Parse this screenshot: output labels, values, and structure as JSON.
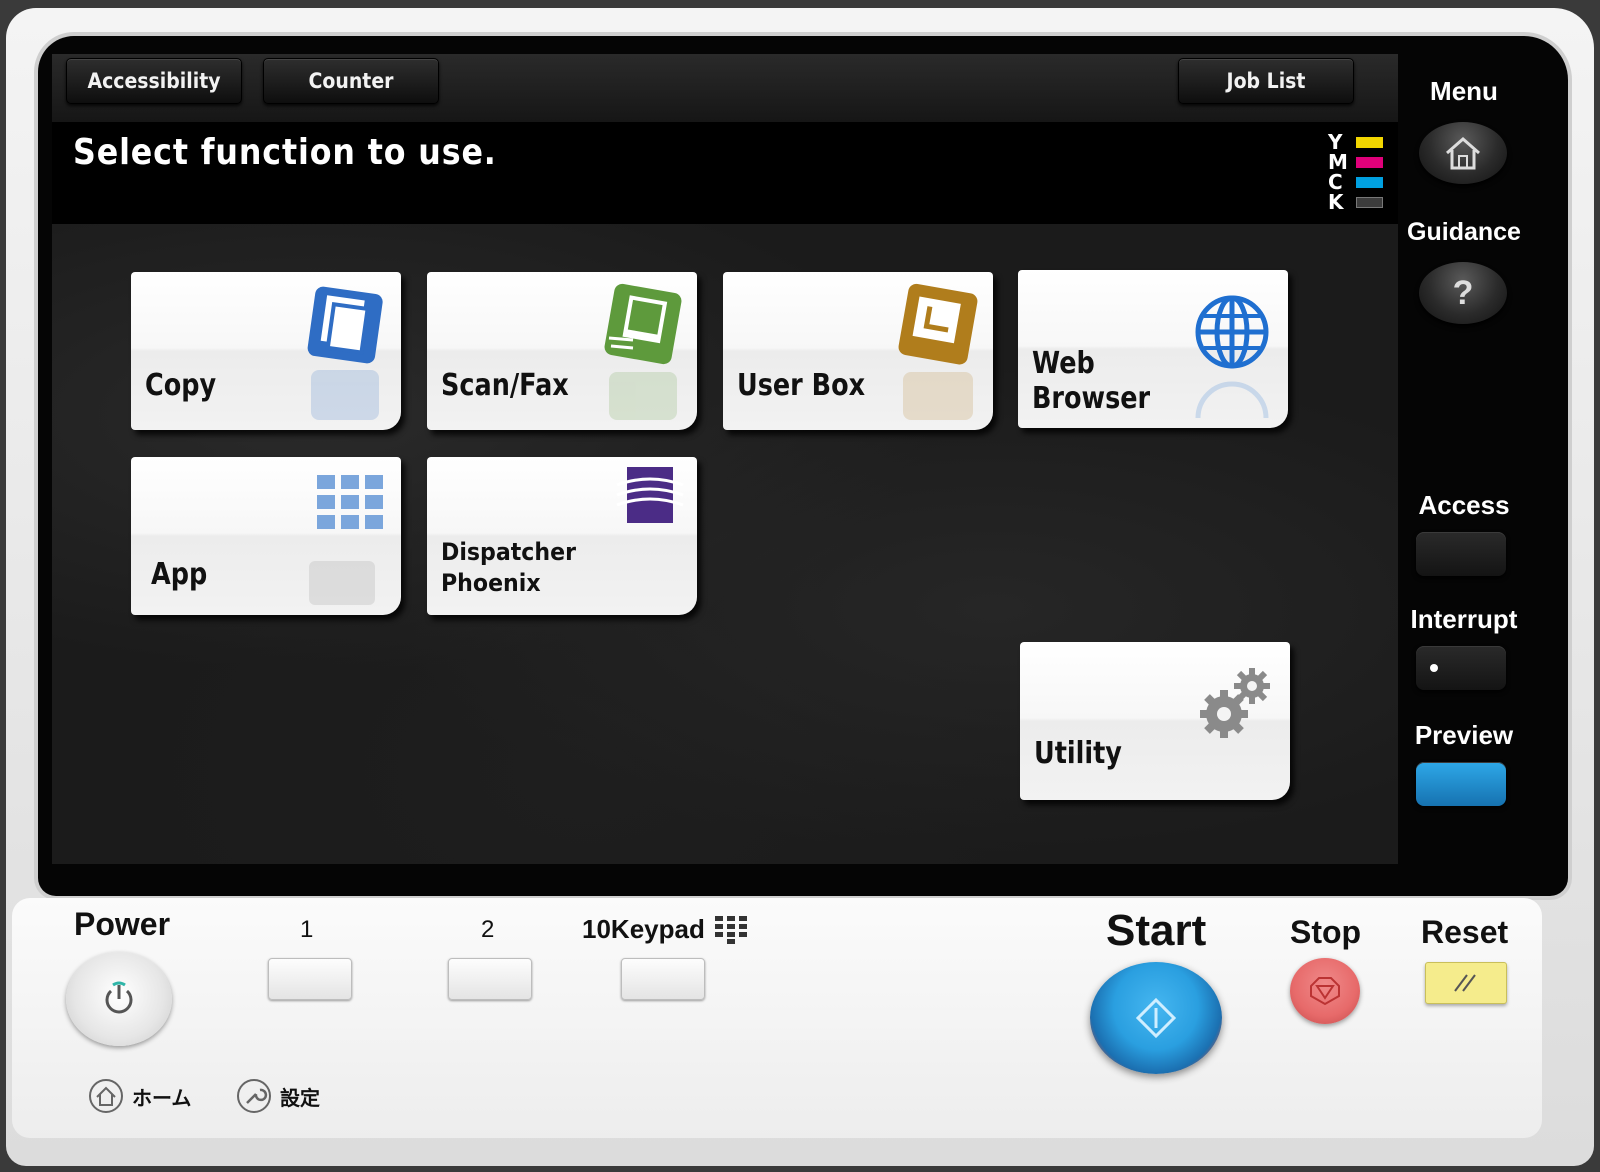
{
  "topbar": {
    "accessibility": "Accessibility",
    "counter": "Counter",
    "job_list": "Job List"
  },
  "message": "Select function to use.",
  "toner": [
    {
      "letter": "Y",
      "color": "#f2d600"
    },
    {
      "letter": "M",
      "color": "#e0007a"
    },
    {
      "letter": "C",
      "color": "#00a0e0"
    },
    {
      "letter": "K",
      "color": "#3c3c3c"
    }
  ],
  "tiles": {
    "copy": "Copy",
    "scan_fax": "Scan/Fax",
    "user_box": "User Box",
    "web_browser": "Web\nBrowser",
    "app": "App",
    "dispatcher": "Dispatcher\nPhoenix",
    "utility": "Utility"
  },
  "side": {
    "menu": "Menu",
    "guidance": "Guidance",
    "guidance_glyph": "?",
    "access": "Access",
    "interrupt": "Interrupt",
    "preview": "Preview"
  },
  "panel": {
    "power": "Power",
    "key1": "1",
    "key2": "2",
    "keypad": "10Keypad",
    "start": "Start",
    "stop": "Stop",
    "reset": "Reset",
    "home": "ホーム",
    "settings": "設定"
  },
  "colors": {
    "preview_led": "#1e90d0",
    "start_button": "#2a9fe0",
    "stop_button": "#e76a6a",
    "reset_button": "#f5ec8c"
  }
}
